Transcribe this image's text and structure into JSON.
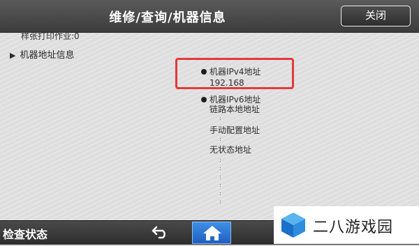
{
  "header": {
    "title": "维修/查询/机器信息",
    "close_label": "关闭"
  },
  "content": {
    "partial_row": "样张打印作业:0",
    "section_label": "机器地址信息",
    "ipv4_label": "机器IPv4地址",
    "ipv4_value": "192.168",
    "ipv6_label": "机器IPv6地址",
    "link_local_label": "链路本地地址",
    "manual_config_label": "手动配置地址",
    "stateless_label": "无状态地址",
    "dots": ":"
  },
  "footer": {
    "status_label": "检查状态"
  },
  "watermark": {
    "text": "二八游戏园"
  },
  "icons": [
    "back-arrow-icon",
    "home-icon",
    "triangle-right-icon",
    "bullet-icon"
  ],
  "colors": {
    "highlight": "#e23a3a",
    "home_button": "#2f78d8",
    "title_bar": "#454545"
  }
}
